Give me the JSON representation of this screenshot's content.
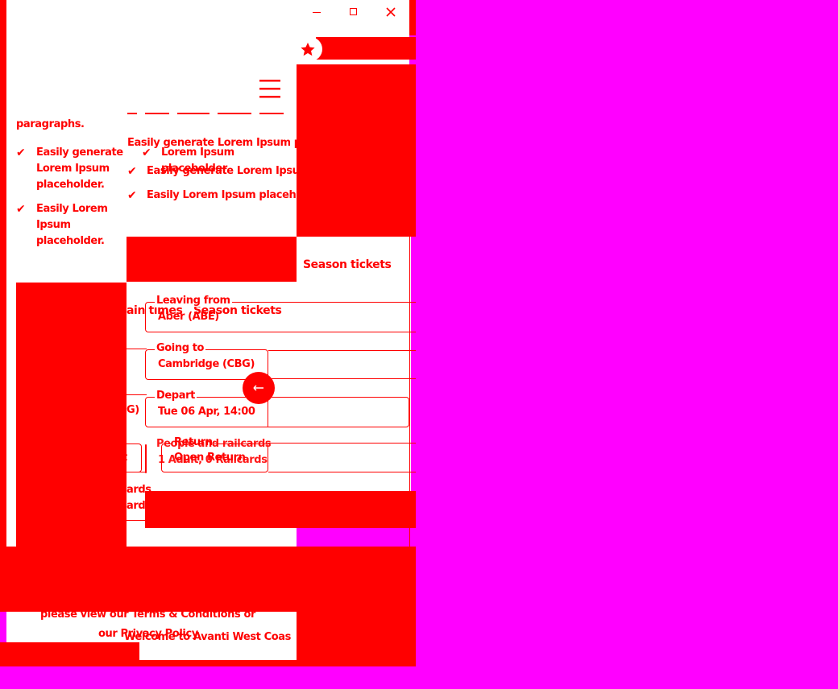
{
  "window": {
    "controls": {
      "minimize": "–",
      "maximize": "☐",
      "close": "✕"
    }
  },
  "address_bar": {
    "value": "",
    "placeholder": ""
  },
  "colors": {
    "accent": "#ff0000",
    "background": "#ff00ff",
    "surface": "#ffffff"
  },
  "icons": {
    "bookmark": "star-icon",
    "menu": "hamburger-menu-icon",
    "check": "check-icon",
    "swap": "swap-icon"
  },
  "left_column": {
    "intro_tail": "paragraphs.",
    "items": [
      {
        "line1": "Easily generate",
        "line2": "Lorem Ipsum",
        "line3": "placeholder."
      },
      {
        "line1": "Easily Lorem",
        "line2": "Ipsum",
        "line3": "placeholder."
      }
    ]
  },
  "middle_column": {
    "intro": "Easily generate Lorem Ipsum pl",
    "items": [
      {
        "line1": "Lorem Ipsum",
        "line2": "placeholder"
      },
      {
        "line1": "Easily generate Lorem Ipsum"
      },
      {
        "line1": "Easily Lorem Ipsum placeho"
      }
    ]
  },
  "tabs": {
    "train_times": "ain times",
    "season_tickets": "Season tickets",
    "season_tickets_right": "Season tickets"
  },
  "booking_form": {
    "leaving_from": {
      "label": "Leaving from",
      "value": "Aber (ABE)"
    },
    "going_to": {
      "label": "Going to",
      "value": "Cambridge (CBG)"
    },
    "depart": {
      "label": "Depart",
      "value": "Tue 06 Apr, 14:00"
    },
    "return": {
      "label": "Return",
      "value": "Open Return"
    },
    "people": {
      "label": "People and railcards",
      "value": "1 Adult, 0 Railcards"
    },
    "ghost_cbg": "G)",
    "ghost_t": "t",
    "ghost_cards1": "ards",
    "ghost_cards2": "ards"
  },
  "footer": {
    "terms_line1": "please view our Terms & Conditions or",
    "terms_line2": "our Privacy Policy",
    "welcome": "Welcome to Avanti West Coas"
  }
}
